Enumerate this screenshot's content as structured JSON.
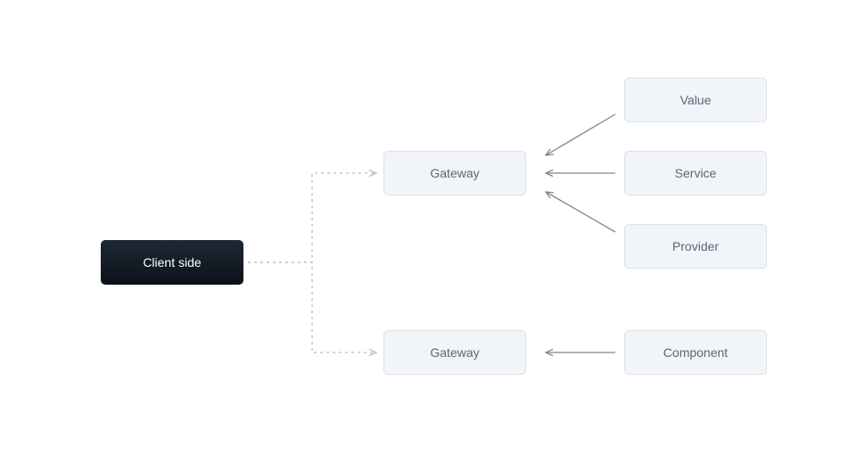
{
  "nodes": {
    "client_side": "Client side",
    "gateway_top": "Gateway",
    "gateway_bottom": "Gateway",
    "value": "Value",
    "service": "Service",
    "provider": "Provider",
    "component": "Component"
  }
}
